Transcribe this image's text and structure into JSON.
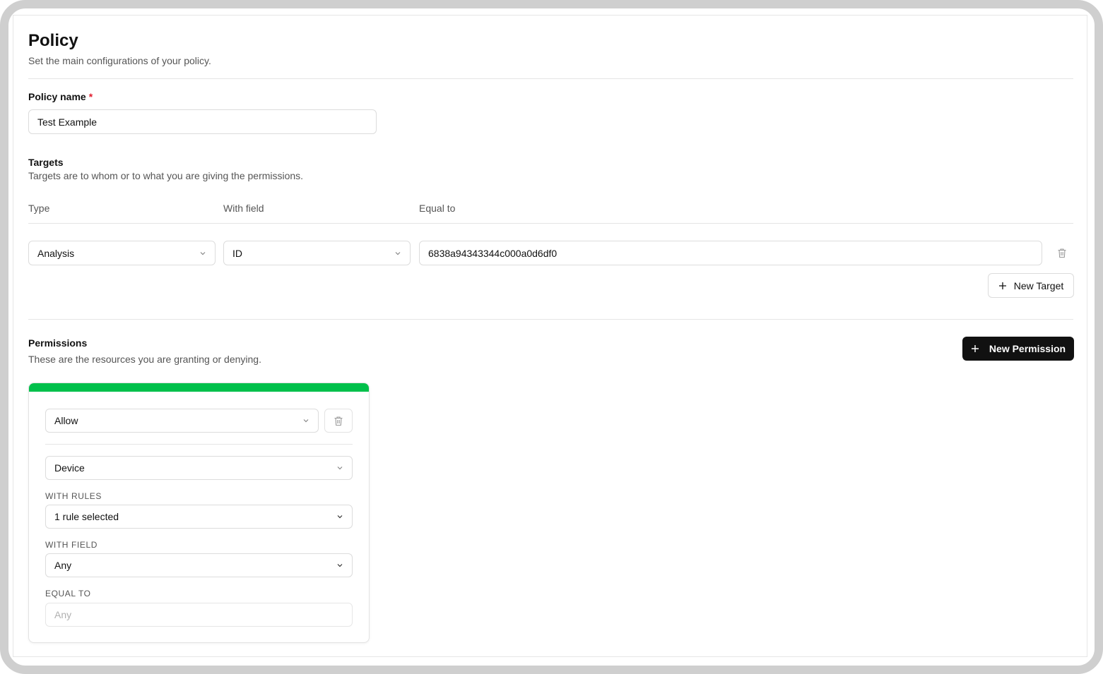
{
  "header": {
    "title": "Policy",
    "subtitle": "Set the main configurations of your policy."
  },
  "policy_name": {
    "label": "Policy name",
    "required_mark": "*",
    "value": "Test Example"
  },
  "targets": {
    "title": "Targets",
    "description": "Targets are to whom or to what you are giving the permissions.",
    "columns": [
      "Type",
      "With field",
      "Equal to"
    ],
    "rows": [
      {
        "type": "Analysis",
        "field": "ID",
        "value": "6838a94343344c000a0d6df0"
      }
    ],
    "new_target_label": "New Target"
  },
  "permissions": {
    "title": "Permissions",
    "description": "These are the resources you are granting or denying.",
    "new_permission_label": "New Permission",
    "cards": [
      {
        "accent_color": "#00c04b",
        "effect": "Allow",
        "resource": "Device",
        "with_rules_label": "WITH RULES",
        "rules_value": "1 rule selected",
        "with_field_label": "WITH FIELD",
        "field_value": "Any",
        "equal_to_label": "EQUAL TO",
        "equal_to_placeholder": "Any"
      }
    ]
  },
  "icons": {
    "chevron": "chevron-down-icon",
    "trash": "trash-icon",
    "plus": "plus-icon"
  }
}
